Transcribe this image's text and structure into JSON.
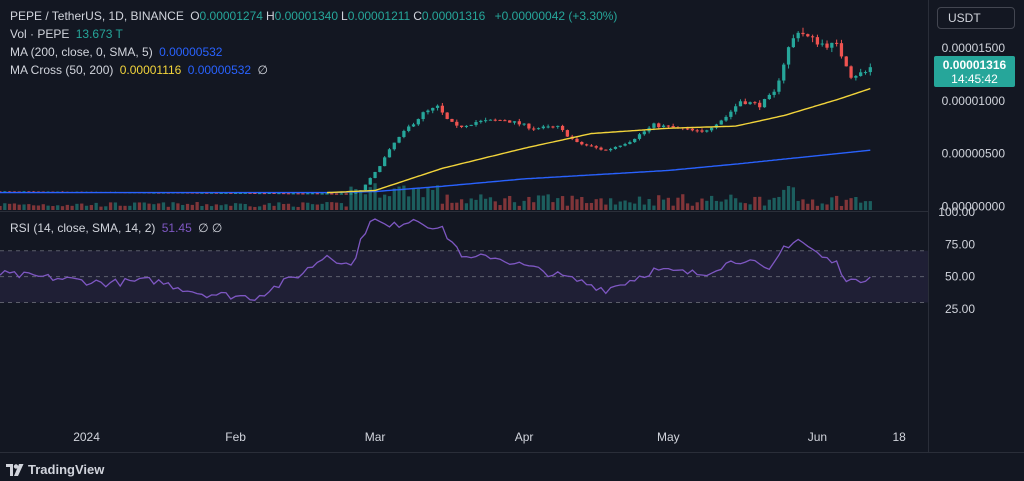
{
  "header": {
    "symbol": "PEPE / TetherUS, 1D, BINANCE",
    "ohlc": [
      {
        "k": "O",
        "v": "0.00001274"
      },
      {
        "k": "H",
        "v": "0.00001340"
      },
      {
        "k": "L",
        "v": "0.00001211"
      },
      {
        "k": "C",
        "v": "0.00001316"
      }
    ],
    "change": "+0.00000042 (+3.30%)"
  },
  "legend": {
    "vol_label": "Vol · PEPE",
    "vol_value": "13.673 T",
    "ma_label": "MA (200, close, 0, SMA, 5)",
    "ma_value": "0.00000532",
    "cross_label": "MA Cross (50, 200)",
    "cross_v1": "0.00001116",
    "cross_v2": "0.00000532",
    "cross_suffix": "∅",
    "rsi_label": "RSI (14, close, SMA, 14, 2)",
    "rsi_value": "51.45",
    "rsi_suffix": "∅ ∅"
  },
  "currency_button": "USDT",
  "price_tag": {
    "price": "0.00001316",
    "countdown": "14:45:42"
  },
  "brand": "TradingView",
  "colors": {
    "up": "#26a69a",
    "down": "#ef5350",
    "ma50": "#f2d43b",
    "ma200": "#2962ff",
    "rsi": "#7e57c2"
  },
  "chart_data": {
    "type": "candlestick",
    "price_axis": {
      "ticks": [
        "0.00001500",
        "0.00001000",
        "0.00000500",
        "0.00000000"
      ],
      "tick_values": [
        1.5e-05,
        1e-05,
        5e-06,
        0
      ],
      "ylim": [
        -3.5e-07,
        1.88e-05
      ]
    },
    "rsi_axis": {
      "ticks": [
        "100.00",
        "75.00",
        "50.00",
        "25.00"
      ],
      "tick_values": [
        100,
        75,
        50,
        25
      ],
      "ylim": [
        18,
        100
      ],
      "band": [
        30,
        70
      ]
    },
    "x_axis": {
      "ticks": [
        "2024",
        "Feb",
        "Mar",
        "Apr",
        "May",
        "Jun",
        "18"
      ],
      "tick_days": [
        "2024-01-01",
        "2024-02-01",
        "2024-03-01",
        "2024-04-01",
        "2024-05-01",
        "2024-06-01",
        "2024-06-18"
      ],
      "xlim": [
        "2023-12-14",
        "2024-06-24"
      ]
    },
    "last_date": "2024-06-12",
    "close_keypoints": [
      [
        "2023-12-14",
        1.4e-06
      ],
      [
        "2024-02-05",
        1.25e-06
      ],
      [
        "2024-02-25",
        1.2e-06
      ],
      [
        "2024-02-27",
        1.5e-06
      ],
      [
        "2024-03-01",
        3.2e-06
      ],
      [
        "2024-03-05",
        6e-06
      ],
      [
        "2024-03-08",
        7.5e-06
      ],
      [
        "2024-03-11",
        8.8e-06
      ],
      [
        "2024-03-14",
        9.4e-06
      ],
      [
        "2024-03-16",
        8.2e-06
      ],
      [
        "2024-03-18",
        7.5e-06
      ],
      [
        "2024-03-22",
        8e-06
      ],
      [
        "2024-03-28",
        8.2e-06
      ],
      [
        "2024-04-03",
        7.4e-06
      ],
      [
        "2024-04-08",
        7.5e-06
      ],
      [
        "2024-04-12",
        6e-06
      ],
      [
        "2024-04-18",
        5.3e-06
      ],
      [
        "2024-04-23",
        6.2e-06
      ],
      [
        "2024-04-28",
        7.7e-06
      ],
      [
        "2024-05-03",
        7.4e-06
      ],
      [
        "2024-05-08",
        7e-06
      ],
      [
        "2024-05-13",
        8.5e-06
      ],
      [
        "2024-05-16",
        1e-05
      ],
      [
        "2024-05-20",
        9.6e-06
      ],
      [
        "2024-05-23",
        1.07e-05
      ],
      [
        "2024-05-26",
        1.5e-05
      ],
      [
        "2024-05-28",
        1.67e-05
      ],
      [
        "2024-05-30",
        1.6e-05
      ],
      [
        "2024-06-02",
        1.54e-05
      ],
      [
        "2024-06-05",
        1.52e-05
      ],
      [
        "2024-06-07",
        1.35e-05
      ],
      [
        "2024-06-08",
        1.24e-05
      ],
      [
        "2024-06-11",
        1.27e-05
      ],
      [
        "2024-06-12",
        1.316e-05
      ]
    ],
    "ma50_keypoints": [
      [
        "2024-02-20",
        1.3e-06
      ],
      [
        "2024-03-01",
        1.5e-06
      ],
      [
        "2024-03-15",
        3.6e-06
      ],
      [
        "2024-04-01",
        5.5e-06
      ],
      [
        "2024-04-15",
        6.9e-06
      ],
      [
        "2024-05-01",
        7.4e-06
      ],
      [
        "2024-05-15",
        7.6e-06
      ],
      [
        "2024-05-25",
        8.6e-06
      ],
      [
        "2024-06-05",
        1.01e-05
      ],
      [
        "2024-06-12",
        1.116e-05
      ]
    ],
    "ma200_keypoints": [
      [
        "2023-12-14",
        1.3e-06
      ],
      [
        "2024-02-20",
        1.3e-06
      ],
      [
        "2024-03-01",
        1.4e-06
      ],
      [
        "2024-03-15",
        1.9e-06
      ],
      [
        "2024-04-01",
        2.6e-06
      ],
      [
        "2024-05-01",
        3.4e-06
      ],
      [
        "2024-05-15",
        4e-06
      ],
      [
        "2024-06-12",
        5.32e-06
      ]
    ],
    "rsi_keypoints": [
      [
        "2023-12-14",
        52
      ],
      [
        "2023-12-25",
        49
      ],
      [
        "2024-01-05",
        45
      ],
      [
        "2024-01-15",
        47
      ],
      [
        "2024-01-25",
        37
      ],
      [
        "2024-02-05",
        34
      ],
      [
        "2024-02-15",
        53
      ],
      [
        "2024-02-20",
        67
      ],
      [
        "2024-02-25",
        58
      ],
      [
        "2024-02-29",
        95
      ],
      [
        "2024-03-04",
        88
      ],
      [
        "2024-03-09",
        95
      ],
      [
        "2024-03-15",
        86
      ],
      [
        "2024-03-20",
        63
      ],
      [
        "2024-03-25",
        66
      ],
      [
        "2024-04-05",
        54
      ],
      [
        "2024-04-12",
        47
      ],
      [
        "2024-04-18",
        40
      ],
      [
        "2024-04-23",
        47
      ],
      [
        "2024-04-28",
        55
      ],
      [
        "2024-05-08",
        52
      ],
      [
        "2024-05-13",
        60
      ],
      [
        "2024-05-17",
        64
      ],
      [
        "2024-05-22",
        53
      ],
      [
        "2024-05-25",
        73
      ],
      [
        "2024-05-28",
        79
      ],
      [
        "2024-06-02",
        65
      ],
      [
        "2024-06-05",
        60
      ],
      [
        "2024-06-07",
        49
      ],
      [
        "2024-06-09",
        45
      ],
      [
        "2024-06-12",
        51.45
      ]
    ]
  }
}
